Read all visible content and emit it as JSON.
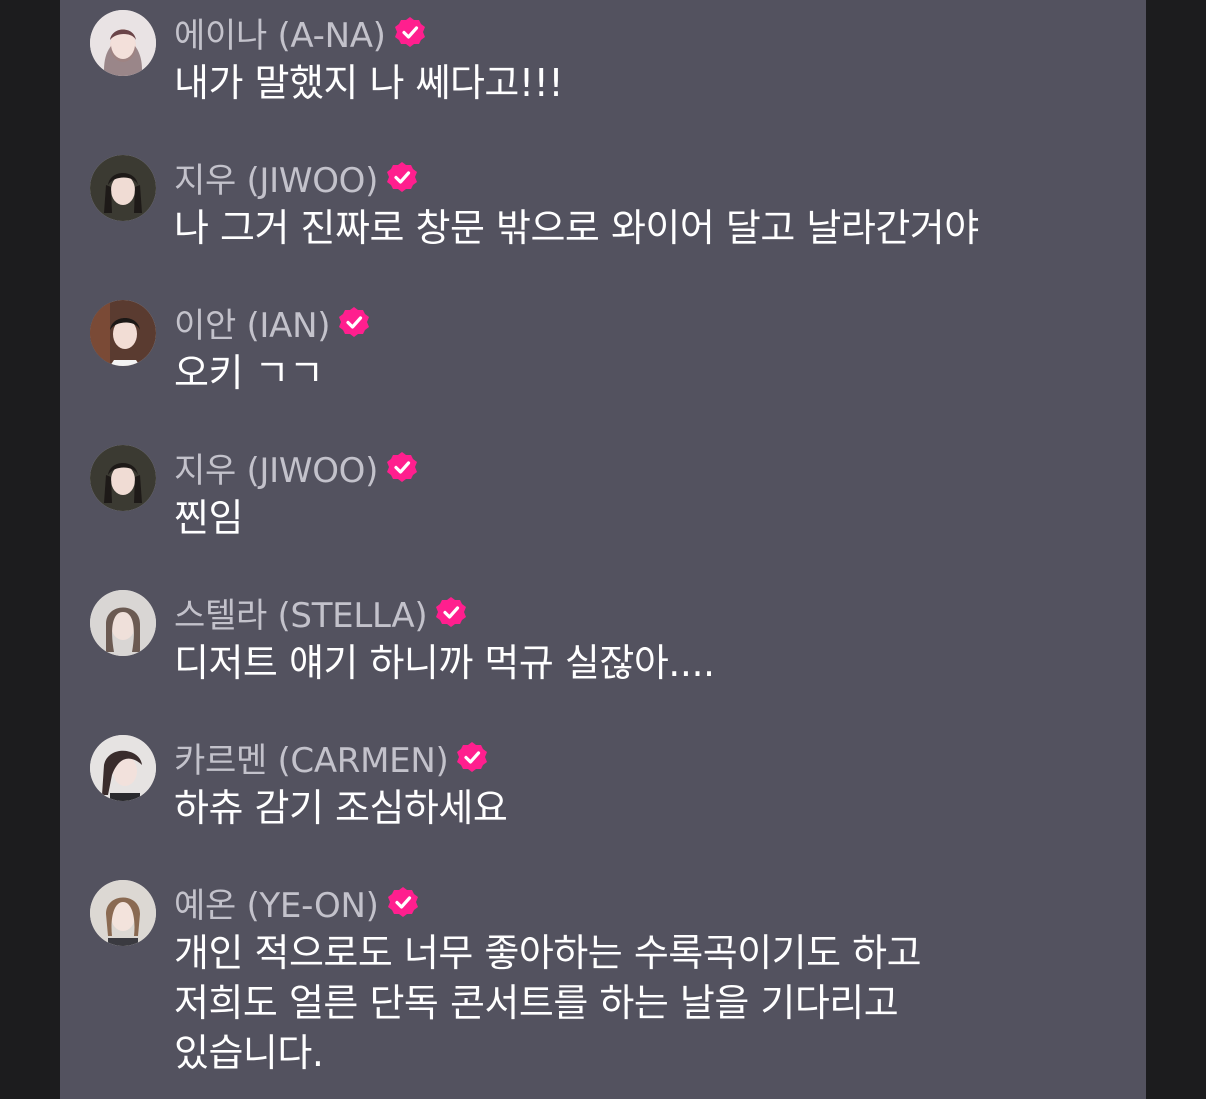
{
  "messages": [
    {
      "name": "에이나 (A-NA)",
      "text": "내가 말했지 나 쎄다고!!!",
      "avatar": "member-ana-avatar"
    },
    {
      "name": "지우 (JIWOO)",
      "text": "나 그거 진짜로 창문 밖으로 와이어 달고 날라간거야",
      "avatar": "member-jiwoo-avatar"
    },
    {
      "name": "이안 (IAN)",
      "text": "오키 ㄱㄱ",
      "avatar": "member-ian-avatar"
    },
    {
      "name": "지우 (JIWOO)",
      "text": "찐임",
      "avatar": "member-jiwoo-avatar"
    },
    {
      "name": "스텔라 (STELLA)",
      "text": "디저트 얘기 하니까 먹규 실잖아....",
      "avatar": "member-stella-avatar"
    },
    {
      "name": "카르멘 (CARMEN)",
      "text": "하츄 감기 조심하세요",
      "avatar": "member-carmen-avatar"
    },
    {
      "name": "예온 (YE-ON)",
      "text": "개인 적으로도 너무 좋아하는 수록곡이기도 하고\n저희도 얼른 단독 콘서트를 하는 날을 기다리고\n있습니다.",
      "avatar": "member-yeon-avatar"
    }
  ],
  "colors": {
    "background": "#1c1c1e",
    "panel": "#53525f",
    "name": "#c3c2cb",
    "text": "#ffffff",
    "verified_badge": "#ff1f8e"
  },
  "icons": {
    "verified": "verified-badge-icon"
  }
}
